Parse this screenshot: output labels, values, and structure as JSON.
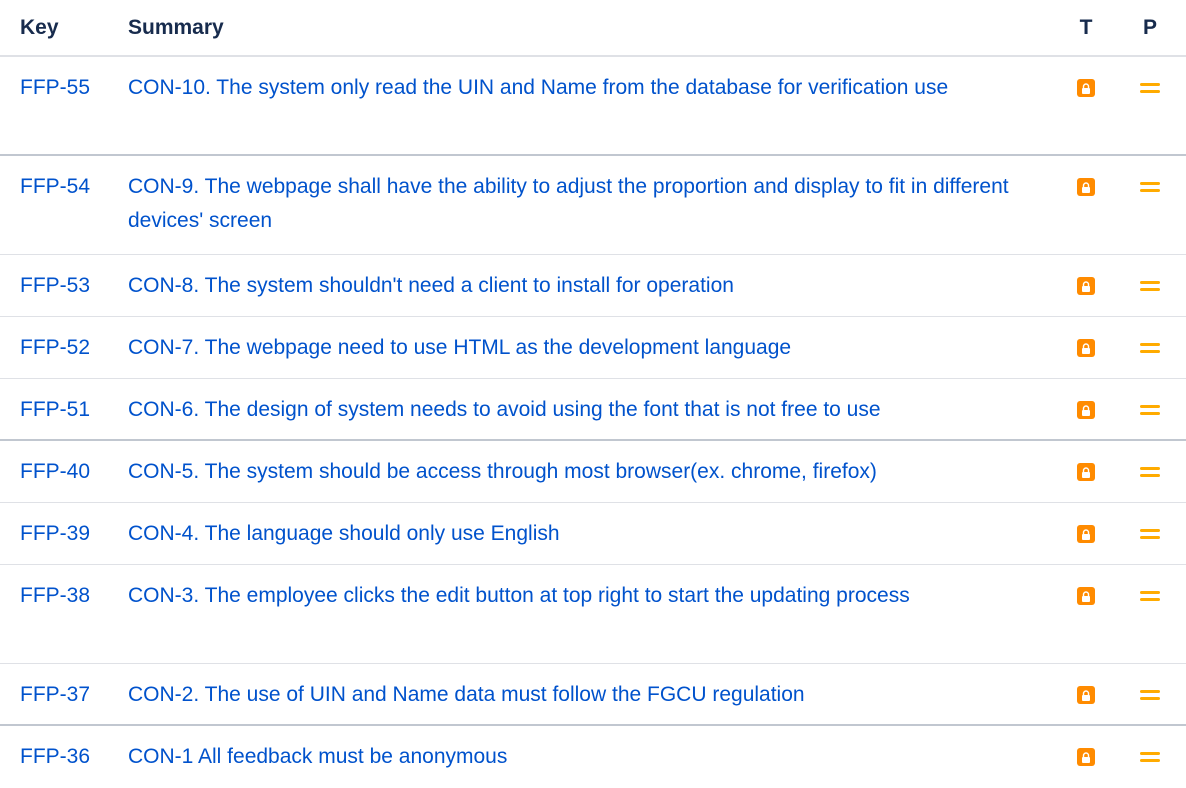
{
  "table": {
    "headers": {
      "key": "Key",
      "summary": "Summary",
      "type": "T",
      "priority": "P"
    },
    "rows": [
      {
        "key": "FFP-55",
        "summary": "CON-10. The system only read the UIN and Name from the database for verification use",
        "type_icon": "lock-icon",
        "priority_icon": "priority-medium-icon"
      },
      {
        "key": "FFP-54",
        "summary": "CON-9. The webpage shall have the ability to adjust the proportion and display to fit in different devices' screen",
        "type_icon": "lock-icon",
        "priority_icon": "priority-medium-icon"
      },
      {
        "key": "FFP-53",
        "summary": "CON-8. The system shouldn't need a client to install for operation",
        "type_icon": "lock-icon",
        "priority_icon": "priority-medium-icon"
      },
      {
        "key": "FFP-52",
        "summary": "CON-7. The webpage need to use HTML as the development language",
        "type_icon": "lock-icon",
        "priority_icon": "priority-medium-icon"
      },
      {
        "key": "FFP-51",
        "summary": "CON-6. The design of system needs to avoid using the font that is not free to use",
        "type_icon": "lock-icon",
        "priority_icon": "priority-medium-icon"
      },
      {
        "key": "FFP-40",
        "summary": "CON-5. The system should be access through most browser(ex. chrome, firefox)",
        "type_icon": "lock-icon",
        "priority_icon": "priority-medium-icon"
      },
      {
        "key": "FFP-39",
        "summary": "CON-4. The language should only use English",
        "type_icon": "lock-icon",
        "priority_icon": "priority-medium-icon"
      },
      {
        "key": "FFP-38",
        "summary": "CON-3. The employee clicks the edit button at top right to start the updating process",
        "type_icon": "lock-icon",
        "priority_icon": "priority-medium-icon"
      },
      {
        "key": "FFP-37",
        "summary": "CON-2. The use of UIN and Name data must follow the FGCU regulation",
        "type_icon": "lock-icon",
        "priority_icon": "priority-medium-icon"
      },
      {
        "key": "FFP-36",
        "summary": "CON-1 All feedback must be anonymous",
        "type_icon": "lock-icon",
        "priority_icon": "priority-medium-icon"
      }
    ]
  },
  "colors": {
    "link": "#0052cc",
    "type_icon_bg": "#ff8b00",
    "priority_medium": "#ffab00",
    "border": "#dfe1e6"
  }
}
